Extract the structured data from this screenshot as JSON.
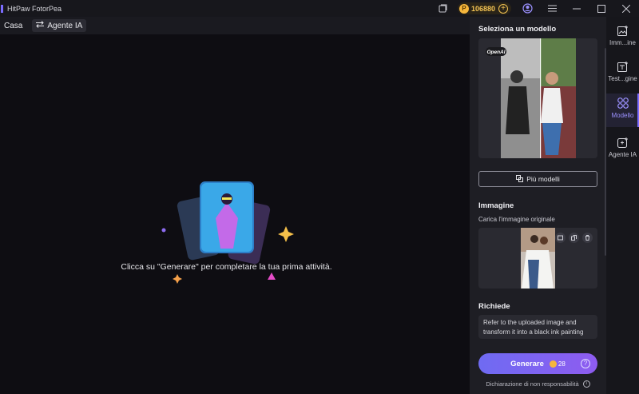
{
  "app": {
    "title": "HitPaw FotorPea"
  },
  "titlebar": {
    "coins": "106880",
    "icons": [
      "gallery-icon",
      "coin-icon",
      "add-coins-icon",
      "account-icon",
      "menu-icon",
      "minimize-icon",
      "maximize-icon",
      "close-icon"
    ]
  },
  "nav": {
    "home": "Casa",
    "agent": "Agente IA"
  },
  "canvas": {
    "empty_message": "Clicca su \"Generare\" per completare la tua prima attività."
  },
  "panel": {
    "model_title": "Seleziona un modello",
    "model_badge": "OpenAI",
    "more_models": "Più modelli",
    "image_title": "Immagine",
    "image_subtitle": "Carica l'immagine originale",
    "prompt_title": "Richiede",
    "prompt_text": "Refer to the uploaded image and transform it into a black ink painting",
    "generate_label": "Generare",
    "generate_cost": "28",
    "disclaimer": "Dichiarazione di non responsabilità"
  },
  "rail": {
    "items": [
      {
        "label": "Imm...ine",
        "icon": "image-icon"
      },
      {
        "label": "Test...gine",
        "icon": "text-to-image-icon"
      },
      {
        "label": "Modello",
        "icon": "model-icon"
      },
      {
        "label": "Agente IA",
        "icon": "ai-agent-icon"
      }
    ],
    "active": "Modello"
  },
  "colors": {
    "accent": "#7b6cff",
    "coin": "#f6b73c",
    "background": "#0e0d12",
    "panel": "#1e1e24"
  }
}
